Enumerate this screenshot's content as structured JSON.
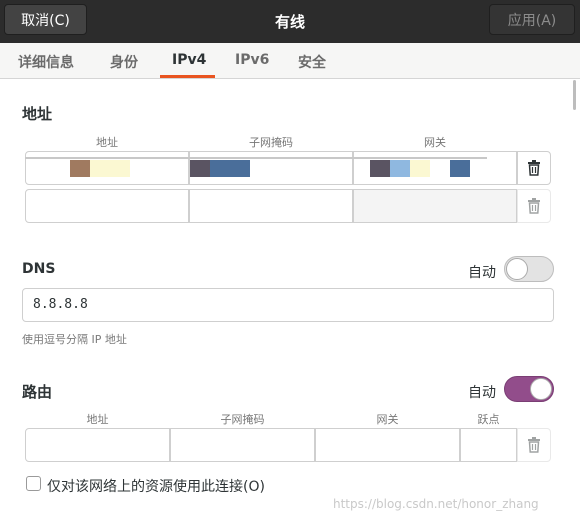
{
  "header": {
    "cancel_label": "取消(C)",
    "title": "有线",
    "apply_label": "应用(A)"
  },
  "tabs": [
    {
      "label": "详细信息"
    },
    {
      "label": "身份"
    },
    {
      "label": "IPv4"
    },
    {
      "label": "IPv6"
    },
    {
      "label": "安全"
    }
  ],
  "active_tab": "IPv4",
  "address": {
    "title": "地址",
    "columns": [
      "地址",
      "子网掩码",
      "网关"
    ]
  },
  "dns": {
    "title": "DNS",
    "auto_label": "自动",
    "auto_on": false,
    "value": "8.8.8.8",
    "hint": "使用逗号分隔 IP 地址"
  },
  "routes": {
    "title": "路由",
    "auto_label": "自动",
    "auto_on": true,
    "columns": [
      "地址",
      "子网掩码",
      "网关",
      "跃点"
    ]
  },
  "checkbox": {
    "label": "仅对该网络上的资源使用此连接(O)",
    "checked": false
  },
  "watermark": "https://blog.csdn.net/honor_zhang",
  "colors": {
    "accent": "#e95420",
    "switch_on": "#924d8b",
    "header_bg": "#2c2c2c"
  }
}
